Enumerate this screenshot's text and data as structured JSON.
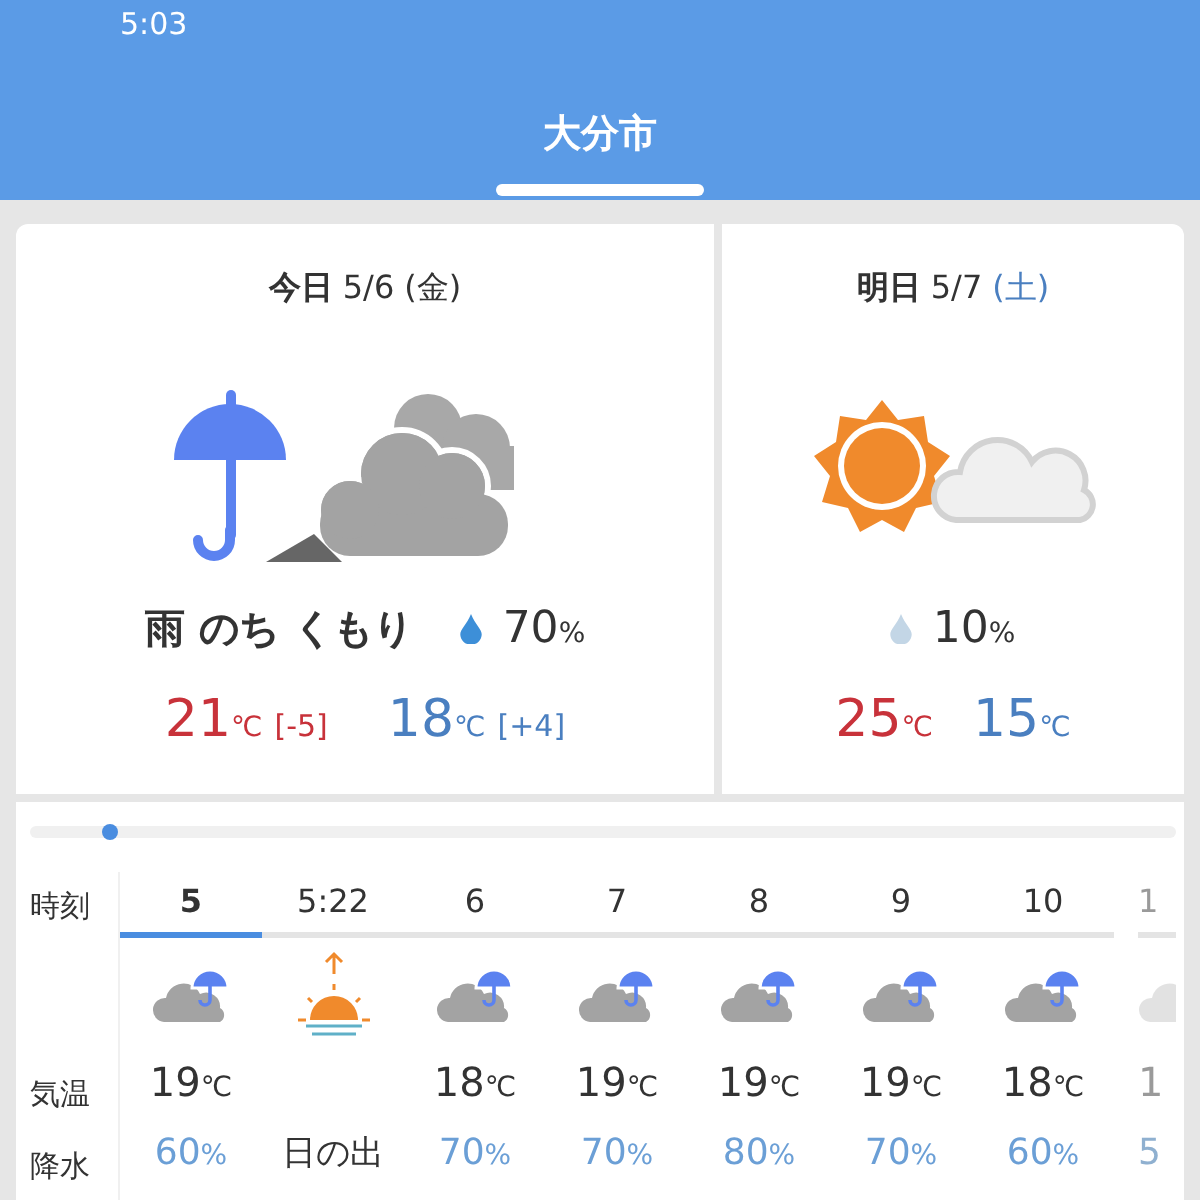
{
  "status_bar": {
    "time": "5:03"
  },
  "header": {
    "title": "大分市"
  },
  "days": [
    {
      "label": "今日",
      "date": "5/6",
      "weekday": "(金)",
      "saturday": false,
      "kind": "rain",
      "weather": "雨 のち くもり",
      "precip": "70",
      "precip_unit": "%",
      "color": "#3d8fd8",
      "high": "21",
      "high_unit": "℃",
      "high_diff": "[-5]",
      "low": "18",
      "low_unit": "℃",
      "low_diff": "[+4]"
    },
    {
      "label": "明日",
      "date": "5/7",
      "weekday": "(土)",
      "saturday": true,
      "kind": "sunny",
      "precip": "10",
      "precip_unit": "%",
      "color": "#c3d6e6",
      "high": "25",
      "high_unit": "℃",
      "low": "15",
      "low_unit": "℃"
    }
  ],
  "hourly": {
    "slider": {
      "level": 0.07
    },
    "row_labels": [
      "時刻",
      "気温",
      "降水"
    ],
    "hours": [
      {
        "time": "5",
        "selected": true,
        "kind": "forecast",
        "temp": "19",
        "unit": "℃",
        "precip": "60",
        "precip_unit": "%"
      },
      {
        "time": "5:22",
        "selected": false,
        "kind": "sunrise",
        "label": "日の出"
      },
      {
        "time": "6",
        "selected": false,
        "kind": "forecast",
        "temp": "18",
        "unit": "℃",
        "precip": "70",
        "precip_unit": "%"
      },
      {
        "time": "7",
        "selected": false,
        "kind": "forecast",
        "temp": "19",
        "unit": "℃",
        "precip": "70",
        "precip_unit": "%"
      },
      {
        "time": "8",
        "selected": false,
        "kind": "forecast",
        "temp": "19",
        "unit": "℃",
        "precip": "80",
        "precip_unit": "%"
      },
      {
        "time": "9",
        "selected": false,
        "kind": "forecast",
        "temp": "19",
        "unit": "℃",
        "precip": "70",
        "precip_unit": "%"
      },
      {
        "time": "10",
        "selected": false,
        "kind": "forecast",
        "temp": "18",
        "unit": "℃",
        "precip": "60",
        "precip_unit": "%"
      },
      {
        "time": "1",
        "selected": false,
        "kind": "partial",
        "temp": "1",
        "precip": "5"
      }
    ]
  }
}
